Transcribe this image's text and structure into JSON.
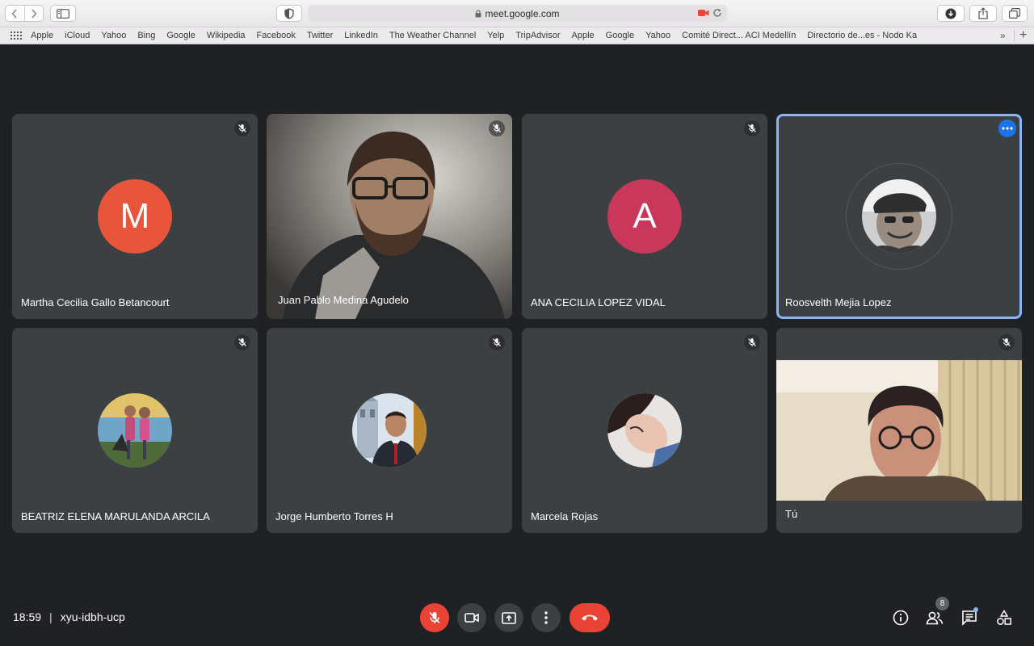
{
  "browser": {
    "url": "meet.google.com",
    "favorites": [
      "Apple",
      "iCloud",
      "Yahoo",
      "Bing",
      "Google",
      "Wikipedia",
      "Facebook",
      "Twitter",
      "LinkedIn",
      "The Weather Channel",
      "Yelp",
      "TripAdvisor",
      "Apple",
      "Google",
      "Yahoo",
      "Comité Direct... ACI Medellín",
      "Directorio de...es - Nodo Ka"
    ],
    "favorites_more": "»"
  },
  "participants": [
    {
      "name": "Martha Cecilia Gallo Betancourt",
      "avatar": "letter",
      "letter": "M",
      "color": "#e8553b",
      "muted": true
    },
    {
      "name": "Juan Pablo Medina Agudelo",
      "avatar": "video",
      "muted": true
    },
    {
      "name": "ANA CECILIA LOPEZ VIDAL",
      "avatar": "letter",
      "letter": "A",
      "color": "#c9375a",
      "muted": true
    },
    {
      "name": "Roosvelth Mejia Lopez",
      "avatar": "photo",
      "muted": false,
      "speaking": true
    },
    {
      "name": "BEATRIZ ELENA MARULANDA ARCILA",
      "avatar": "photo",
      "muted": true
    },
    {
      "name": "Jorge Humberto Torres H",
      "avatar": "photo",
      "muted": true
    },
    {
      "name": "Marcela Rojas",
      "avatar": "photo",
      "muted": true
    },
    {
      "name": "Tú",
      "avatar": "video",
      "muted": true
    }
  ],
  "meeting": {
    "time": "18:59",
    "divider": "|",
    "code": "xyu-idbh-ucp",
    "participant_count": "8"
  },
  "colors": {
    "background": "#202124",
    "tile": "#3c4043",
    "red": "#ea4335",
    "active_border": "#8ab4f8",
    "menu_blue": "#1a73e8"
  }
}
